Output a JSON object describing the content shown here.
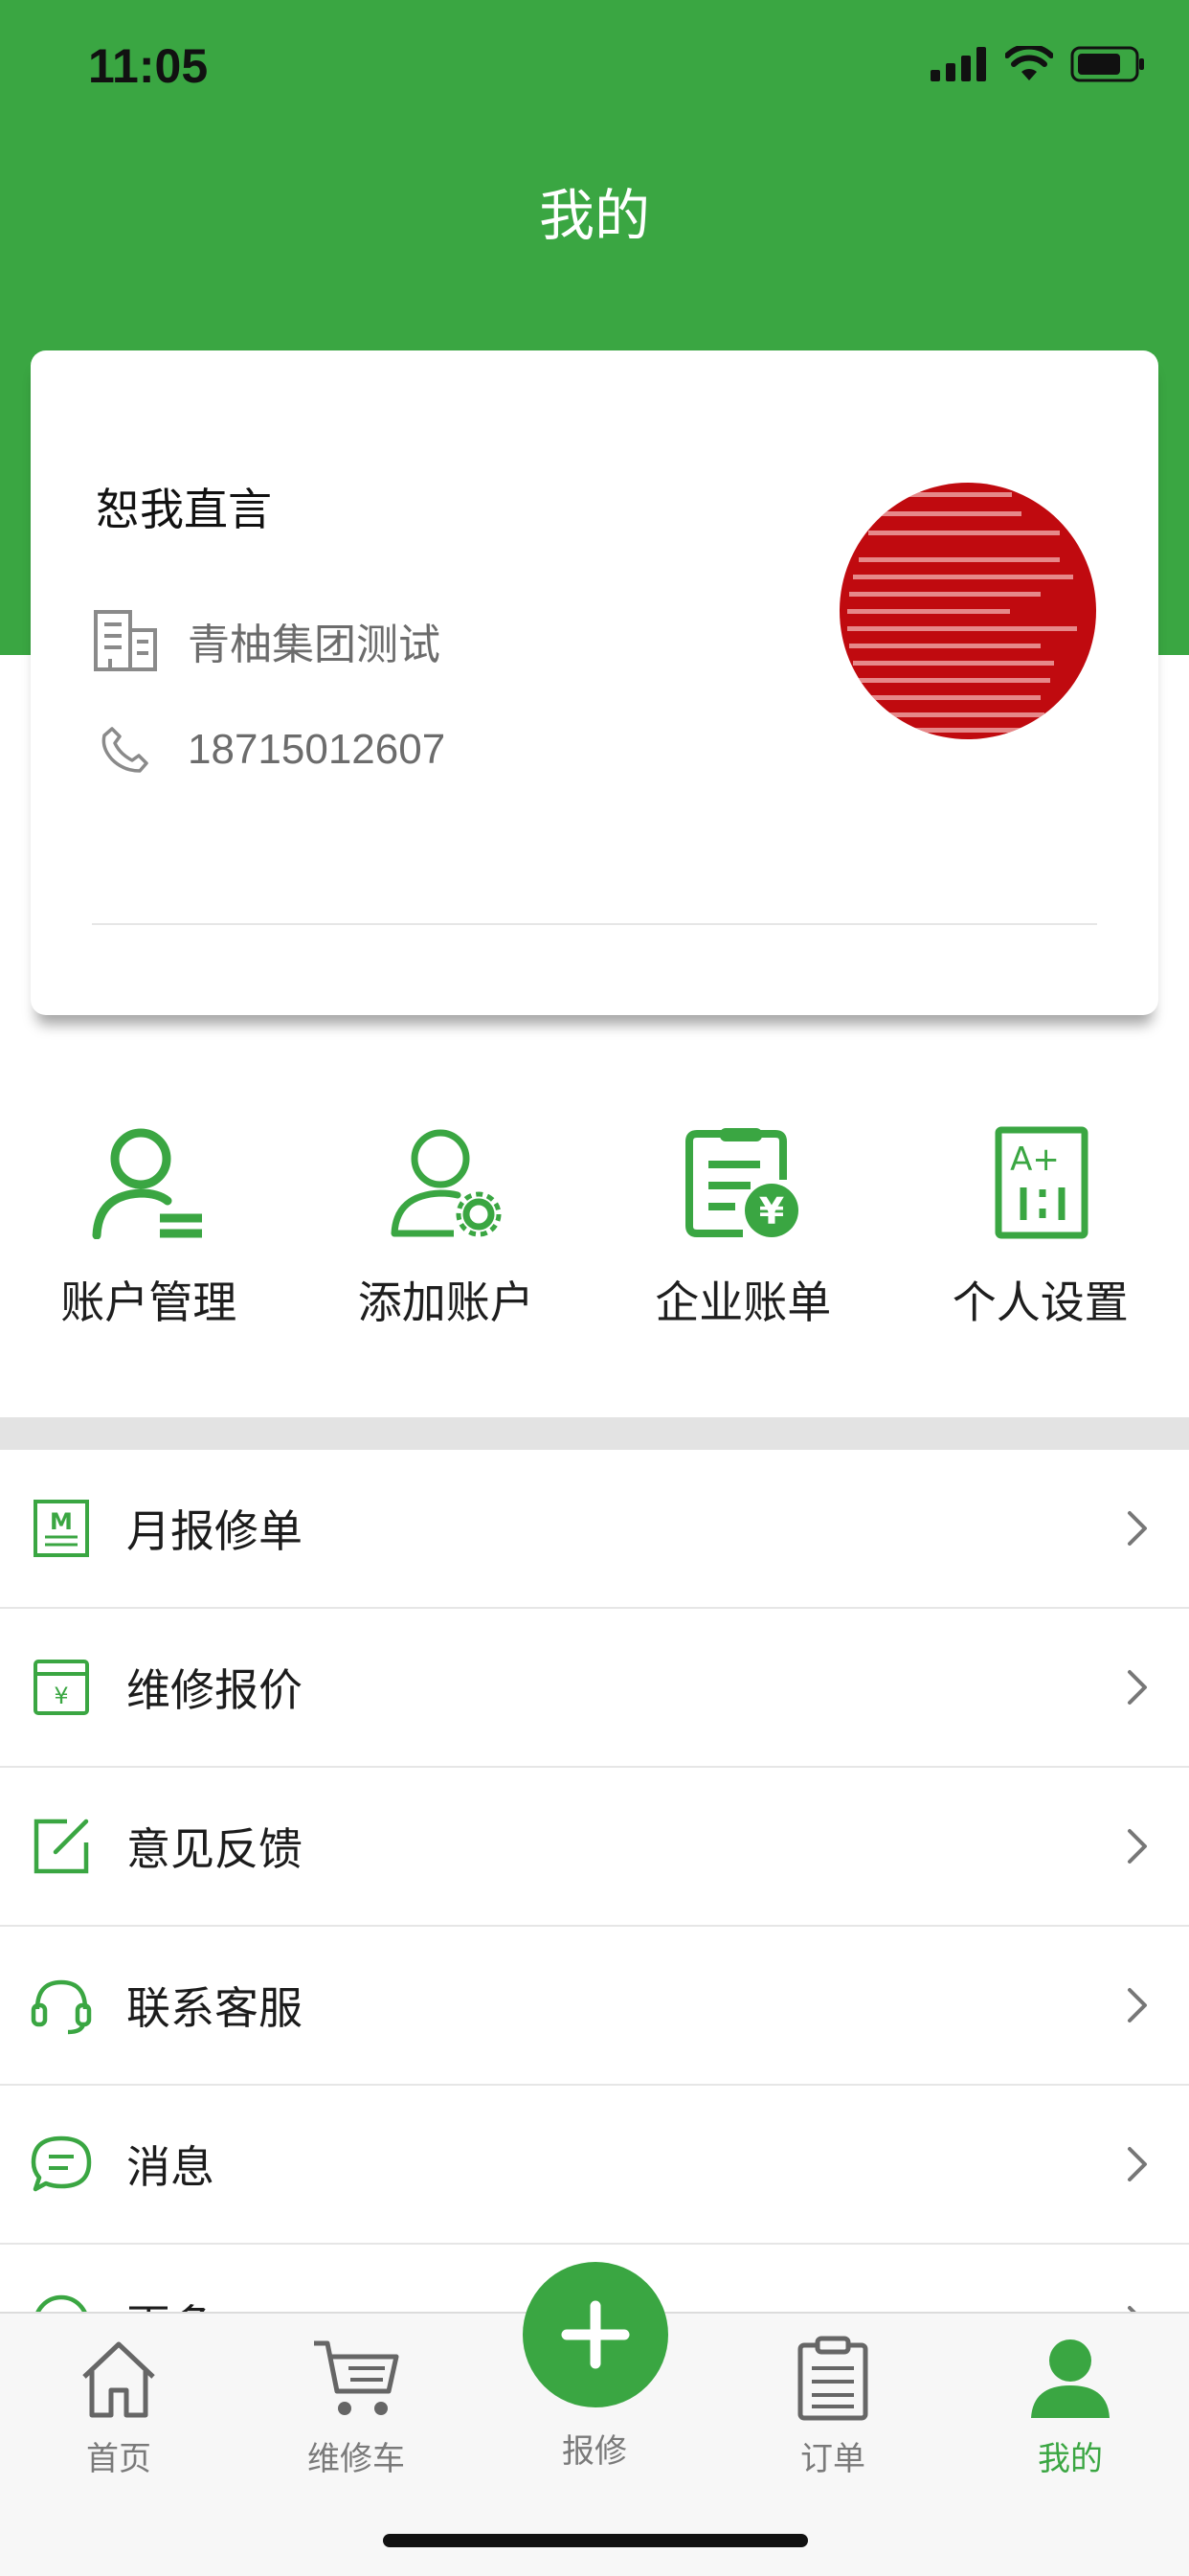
{
  "status_bar": {
    "time": "11:05"
  },
  "header": {
    "title": "我的"
  },
  "profile": {
    "name": "恕我直言",
    "company": "青柚集团测试",
    "phone": "18715012607"
  },
  "quick_actions": [
    {
      "label": "账户管理",
      "icon": "account-manage-icon"
    },
    {
      "label": "添加账户",
      "icon": "add-account-icon"
    },
    {
      "label": "企业账单",
      "icon": "enterprise-bill-icon"
    },
    {
      "label": "个人设置",
      "icon": "personal-settings-icon"
    }
  ],
  "menu": [
    {
      "label": "月报修单",
      "icon": "monthly-report-icon"
    },
    {
      "label": "维修报价",
      "icon": "repair-quote-icon"
    },
    {
      "label": "意见反馈",
      "icon": "feedback-icon"
    },
    {
      "label": "联系客服",
      "icon": "headset-icon"
    },
    {
      "label": "消息",
      "icon": "message-icon"
    },
    {
      "label": "更多",
      "icon": "more-icon"
    }
  ],
  "tab_bar": [
    {
      "label": "首页",
      "icon": "home-icon"
    },
    {
      "label": "维修车",
      "icon": "cart-icon"
    },
    {
      "label": "报修",
      "icon": "plus-icon"
    },
    {
      "label": "订单",
      "icon": "clipboard-icon"
    },
    {
      "label": "我的",
      "icon": "person-icon",
      "active": true
    }
  ],
  "colors": {
    "brand": "#3aa642",
    "avatar_bg": "#c00a0f"
  }
}
